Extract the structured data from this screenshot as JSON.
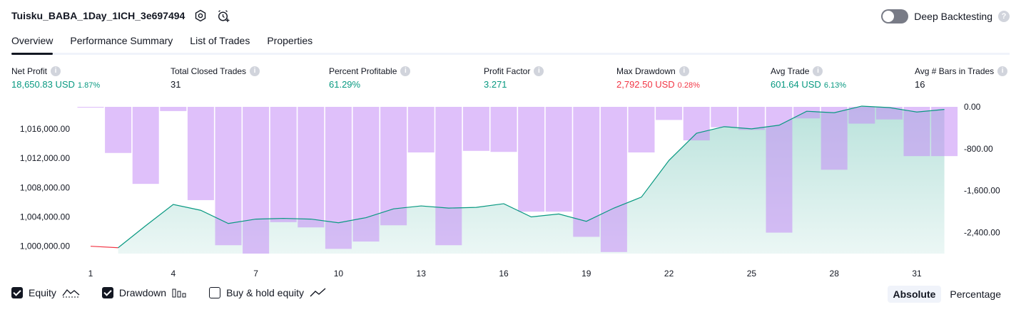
{
  "header": {
    "title": "Tuisku_BABA_1Day_1ICH_3e697494",
    "deep_backtesting_label": "Deep Backtesting"
  },
  "tabs": [
    "Overview",
    "Performance Summary",
    "List of Trades",
    "Properties"
  ],
  "metrics": [
    {
      "label": "Net Profit",
      "value": "18,650.83 USD",
      "pct": "1.87%",
      "color": "#089981"
    },
    {
      "label": "Total Closed Trades",
      "value": "31",
      "pct": "",
      "color": "#131722"
    },
    {
      "label": "Percent Profitable",
      "value": "61.29%",
      "pct": "",
      "color": "#089981"
    },
    {
      "label": "Profit Factor",
      "value": "3.271",
      "pct": "",
      "color": "#089981"
    },
    {
      "label": "Max Drawdown",
      "value": "2,792.50 USD",
      "pct": "0.28%",
      "color": "#f23645"
    },
    {
      "label": "Avg Trade",
      "value": "601.64 USD",
      "pct": "6.13%",
      "color": "#089981"
    },
    {
      "label": "Avg # Bars in Trades",
      "value": "16",
      "pct": "",
      "color": "#131722"
    }
  ],
  "legend": {
    "equity": "Equity",
    "drawdown": "Drawdown",
    "buy_hold": "Buy & hold equity"
  },
  "mode": {
    "absolute": "Absolute",
    "percentage": "Percentage"
  },
  "chart_data": {
    "type": "line",
    "x_ticks": [
      1,
      4,
      7,
      10,
      13,
      16,
      19,
      22,
      25,
      28,
      31
    ],
    "left_axis": {
      "ticks": [
        "1,000,000.00",
        "1,004,000.00",
        "1,008,000.00",
        "1,012,000.00",
        "1,016,000.00"
      ],
      "ylim": [
        999000,
        1019000
      ]
    },
    "right_axis": {
      "ticks": [
        "0.00",
        "-800.00",
        "-1,600.00",
        "-2,400.00"
      ],
      "ylim": [
        -2800,
        0
      ]
    },
    "series": [
      {
        "name": "Equity",
        "x": [
          1,
          2,
          3,
          4,
          5,
          6,
          7,
          8,
          9,
          10,
          11,
          12,
          13,
          14,
          15,
          16,
          17,
          18,
          19,
          20,
          21,
          22,
          23,
          24,
          25,
          26,
          27,
          28,
          29,
          30,
          31,
          32
        ],
        "values": [
          1000000,
          999800,
          1002800,
          1005700,
          1004900,
          1003100,
          1003700,
          1003800,
          1003700,
          1003200,
          1003900,
          1005100,
          1005500,
          1005200,
          1005300,
          1005800,
          1004000,
          1004400,
          1003400,
          1005200,
          1006700,
          1011700,
          1015400,
          1016300,
          1016000,
          1016500,
          1018400,
          1018200,
          1019100,
          1018900,
          1018300,
          1018650
        ]
      },
      {
        "name": "Drawdown",
        "x": [
          1,
          2,
          3,
          4,
          5,
          6,
          7,
          8,
          9,
          10,
          11,
          12,
          13,
          14,
          15,
          16,
          17,
          18,
          19,
          20,
          21,
          22,
          23,
          24,
          25,
          26,
          27,
          28,
          29,
          30,
          31,
          32
        ],
        "values": [
          -15,
          -880,
          -1470,
          -80,
          -1780,
          -2640,
          -2800,
          -2200,
          -2300,
          -2710,
          -2570,
          -2260,
          -870,
          -2640,
          -840,
          -860,
          -2000,
          -2000,
          -2480,
          -2770,
          -870,
          -250,
          -640,
          -390,
          -440,
          -2400,
          -220,
          -1200,
          -320,
          -240,
          -940,
          -940
        ]
      }
    ]
  }
}
